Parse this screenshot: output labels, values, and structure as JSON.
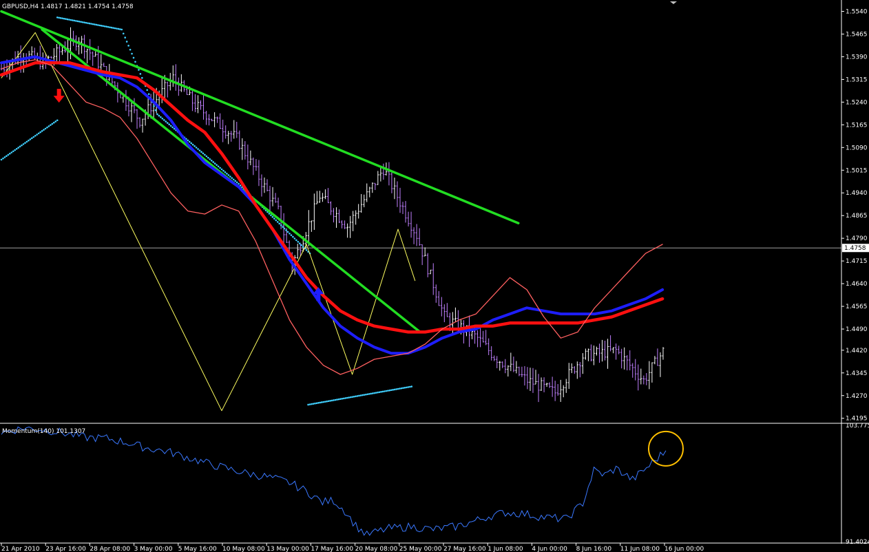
{
  "header": {
    "price_title": "GBPUSD,H4  1.4817 1.4821 1.4754 1.4758",
    "indicator_title": "Momentum(140) 101.1307"
  },
  "colors": {
    "background": "#000000",
    "candle_up": "#ffffff",
    "candle_down": "#c080ff",
    "fast_ma": "#ff6060",
    "ma_blue": "#1e1eff",
    "ma_red": "#ff1010",
    "trendline": "#22dd22",
    "zigzag": "#ffff60",
    "sar_dots": "#40d0ff",
    "momentum": "#3a78ff",
    "highlight_circle": "#ffc000",
    "sell_arrow": "#ff1010",
    "buy_arrow": "#1e1eff"
  },
  "chart_data": [
    {
      "type": "line",
      "title": "GBPUSD,H4",
      "ohlc_last": {
        "open": 1.4817,
        "high": 1.4821,
        "low": 1.4754,
        "close": 1.4758
      },
      "current_price_label": "1.4758",
      "current_price": 1.4758,
      "y_ticks": [
        "1.5540",
        "1.5465",
        "1.5390",
        "1.5315",
        "1.5240",
        "1.5165",
        "1.5090",
        "1.5015",
        "1.4940",
        "1.4865",
        "1.4790",
        "1.4715",
        "1.4640",
        "1.4565",
        "1.4490",
        "1.4420",
        "1.4345",
        "1.4270",
        "1.4195"
      ],
      "ylim": [
        1.4183,
        1.5573
      ],
      "x_ticks": [
        "21 Apr 2010",
        "23 Apr 16:00",
        "28 Apr 08:00",
        "3 May 00:00",
        "5 May 16:00",
        "10 May 08:00",
        "13 May 00:00",
        "17 May 16:00",
        "20 May 08:00",
        "25 May 00:00",
        "27 May 16:00",
        "1 Jun 08:00",
        "4 Jun 00:00",
        "8 Jun 16:00",
        "11 Jun 08:00",
        "16 Jun 00:00"
      ],
      "bars": 240,
      "price_path": [
        [
          0,
          1.535
        ],
        [
          8,
          1.54
        ],
        [
          15,
          1.537
        ],
        [
          28,
          1.545
        ],
        [
          35,
          1.537
        ],
        [
          50,
          1.518
        ],
        [
          62,
          1.532
        ],
        [
          70,
          1.523
        ],
        [
          85,
          1.512
        ],
        [
          100,
          1.488
        ],
        [
          105,
          1.47
        ],
        [
          115,
          1.493
        ],
        [
          125,
          1.483
        ],
        [
          138,
          1.502
        ],
        [
          150,
          1.48
        ],
        [
          160,
          1.453
        ],
        [
          172,
          1.446
        ],
        [
          178,
          1.44
        ],
        [
          190,
          1.432
        ],
        [
          200,
          1.428
        ],
        [
          210,
          1.44
        ],
        [
          222,
          1.442
        ],
        [
          232,
          1.432
        ],
        [
          240,
          1.443
        ],
        [
          252,
          1.45
        ],
        [
          262,
          1.456
        ],
        [
          272,
          1.448
        ],
        [
          282,
          1.455
        ],
        [
          292,
          1.473
        ],
        [
          298,
          1.463
        ],
        [
          308,
          1.463
        ],
        [
          318,
          1.445
        ],
        [
          328,
          1.447
        ],
        [
          335,
          1.441
        ],
        [
          345,
          1.458
        ],
        [
          355,
          1.468
        ],
        [
          368,
          1.458
        ],
        [
          376,
          1.474
        ],
        [
          384,
          1.479
        ],
        [
          392,
          1.478
        ]
      ],
      "series": [
        {
          "name": "fast MA",
          "values": [
            [
              0,
              1.535
            ],
            [
              10,
              1.537
            ],
            [
              20,
              1.538
            ],
            [
              30,
              1.536
            ],
            [
              40,
              1.53
            ],
            [
              50,
              1.524
            ],
            [
              60,
              1.522
            ],
            [
              70,
              1.519
            ],
            [
              80,
              1.512
            ],
            [
              90,
              1.503
            ],
            [
              100,
              1.494
            ],
            [
              110,
              1.488
            ],
            [
              120,
              1.487
            ],
            [
              130,
              1.49
            ],
            [
              140,
              1.488
            ],
            [
              150,
              1.478
            ],
            [
              160,
              1.465
            ],
            [
              170,
              1.452
            ],
            [
              180,
              1.443
            ],
            [
              190,
              1.437
            ],
            [
              200,
              1.434
            ],
            [
              210,
              1.436
            ],
            [
              220,
              1.439
            ],
            [
              230,
              1.44
            ],
            [
              240,
              1.441
            ],
            [
              250,
              1.444
            ],
            [
              260,
              1.449
            ],
            [
              270,
              1.452
            ],
            [
              280,
              1.454
            ],
            [
              290,
              1.46
            ],
            [
              300,
              1.466
            ],
            [
              310,
              1.462
            ],
            [
              320,
              1.453
            ],
            [
              330,
              1.446
            ],
            [
              340,
              1.448
            ],
            [
              350,
              1.456
            ],
            [
              360,
              1.462
            ],
            [
              370,
              1.468
            ],
            [
              380,
              1.474
            ],
            [
              390,
              1.477
            ]
          ]
        },
        {
          "name": "blue MA",
          "values": [
            [
              0,
              1.537
            ],
            [
              20,
              1.539
            ],
            [
              40,
              1.536
            ],
            [
              60,
              1.533
            ],
            [
              70,
              1.532
            ],
            [
              80,
              1.529
            ],
            [
              90,
              1.524
            ],
            [
              100,
              1.518
            ],
            [
              110,
              1.51
            ],
            [
              120,
              1.504
            ],
            [
              130,
              1.5
            ],
            [
              140,
              1.496
            ],
            [
              150,
              1.49
            ],
            [
              160,
              1.482
            ],
            [
              170,
              1.472
            ],
            [
              180,
              1.464
            ],
            [
              190,
              1.456
            ],
            [
              200,
              1.45
            ],
            [
              210,
              1.446
            ],
            [
              220,
              1.443
            ],
            [
              230,
              1.441
            ],
            [
              240,
              1.441
            ],
            [
              250,
              1.443
            ],
            [
              260,
              1.446
            ],
            [
              270,
              1.448
            ],
            [
              280,
              1.449
            ],
            [
              290,
              1.452
            ],
            [
              300,
              1.454
            ],
            [
              310,
              1.456
            ],
            [
              320,
              1.455
            ],
            [
              330,
              1.454
            ],
            [
              340,
              1.454
            ],
            [
              350,
              1.454
            ],
            [
              360,
              1.455
            ],
            [
              370,
              1.457
            ],
            [
              380,
              1.459
            ],
            [
              390,
              1.462
            ]
          ]
        },
        {
          "name": "red MA",
          "values": [
            [
              0,
              1.533
            ],
            [
              20,
              1.537
            ],
            [
              40,
              1.537
            ],
            [
              60,
              1.534
            ],
            [
              80,
              1.532
            ],
            [
              90,
              1.528
            ],
            [
              100,
              1.523
            ],
            [
              110,
              1.518
            ],
            [
              120,
              1.514
            ],
            [
              130,
              1.507
            ],
            [
              140,
              1.499
            ],
            [
              150,
              1.49
            ],
            [
              160,
              1.482
            ],
            [
              170,
              1.474
            ],
            [
              180,
              1.466
            ],
            [
              190,
              1.46
            ],
            [
              200,
              1.455
            ],
            [
              210,
              1.452
            ],
            [
              220,
              1.45
            ],
            [
              230,
              1.449
            ],
            [
              240,
              1.448
            ],
            [
              250,
              1.448
            ],
            [
              260,
              1.449
            ],
            [
              270,
              1.449
            ],
            [
              280,
              1.45
            ],
            [
              290,
              1.45
            ],
            [
              300,
              1.451
            ],
            [
              310,
              1.451
            ],
            [
              320,
              1.451
            ],
            [
              330,
              1.451
            ],
            [
              340,
              1.451
            ],
            [
              350,
              1.452
            ],
            [
              360,
              1.453
            ],
            [
              370,
              1.455
            ],
            [
              380,
              1.457
            ],
            [
              390,
              1.459
            ]
          ]
        },
        {
          "name": "trendline 1",
          "values": [
            [
              0,
              1.554
            ],
            [
              305,
              1.484
            ]
          ]
        },
        {
          "name": "trendline 2",
          "values": [
            [
              24,
              1.548
            ],
            [
              247,
              1.448
            ]
          ]
        },
        {
          "name": "zigzag",
          "values": [
            [
              0,
              1.532
            ],
            [
              20,
              1.547
            ],
            [
              130,
              1.422
            ],
            [
              180,
              1.477
            ],
            [
              207,
              1.434
            ],
            [
              234,
              1.482
            ],
            [
              244,
              1.465
            ]
          ]
        },
        {
          "name": "SAR dots 1",
          "values": [
            [
              0,
              1.505
            ],
            [
              33,
              1.518
            ]
          ]
        },
        {
          "name": "SAR dots 2",
          "values": [
            [
              33,
              1.552
            ],
            [
              71,
              1.548
            ],
            [
              92,
              1.52
            ],
            [
              140,
              1.497
            ],
            [
              182,
              1.474
            ]
          ]
        },
        {
          "name": "SAR dots 3",
          "values": [
            [
              181,
              1.424
            ],
            [
              242,
              1.43
            ]
          ]
        }
      ],
      "markers": [
        {
          "type": "sell_arrow",
          "x": 34,
          "y": 1.5252
        },
        {
          "type": "buy_arrow",
          "x": 187,
          "y": 1.461
        }
      ]
    },
    {
      "type": "line",
      "title": "Momentum(140)",
      "last_value": 101.1307,
      "y_ticks": [
        "103.775",
        "91.4024"
      ],
      "ylim": [
        91.4,
        103.78
      ],
      "values": [
        [
          0,
          103.0
        ],
        [
          8,
          103.5
        ],
        [
          16,
          103.3
        ],
        [
          22,
          103.0
        ],
        [
          30,
          102.5
        ],
        [
          38,
          102.4
        ],
        [
          46,
          101.9
        ],
        [
          52,
          101.4
        ],
        [
          60,
          101.0
        ],
        [
          68,
          100.3
        ],
        [
          76,
          99.6
        ],
        [
          84,
          99.0
        ],
        [
          90,
          98.6
        ],
        [
          96,
          98.3
        ],
        [
          104,
          97.7
        ],
        [
          110,
          96.8
        ],
        [
          116,
          95.6
        ],
        [
          120,
          95.8
        ],
        [
          124,
          94.7
        ],
        [
          128,
          93.1
        ],
        [
          132,
          92.1
        ],
        [
          136,
          92.5
        ],
        [
          140,
          92.8
        ],
        [
          148,
          93.0
        ],
        [
          156,
          92.7
        ],
        [
          164,
          93.0
        ],
        [
          170,
          93.5
        ],
        [
          176,
          94.1
        ],
        [
          182,
          94.5
        ],
        [
          188,
          94.4
        ],
        [
          196,
          94.0
        ],
        [
          204,
          93.8
        ],
        [
          210,
          95.5
        ],
        [
          214,
          99.0
        ],
        [
          218,
          98.5
        ],
        [
          222,
          99.2
        ],
        [
          228,
          98.0
        ],
        [
          234,
          99.5
        ],
        [
          240,
          101.1
        ]
      ],
      "highlight_circle": {
        "x": 240,
        "y": 101.3
      }
    }
  ]
}
